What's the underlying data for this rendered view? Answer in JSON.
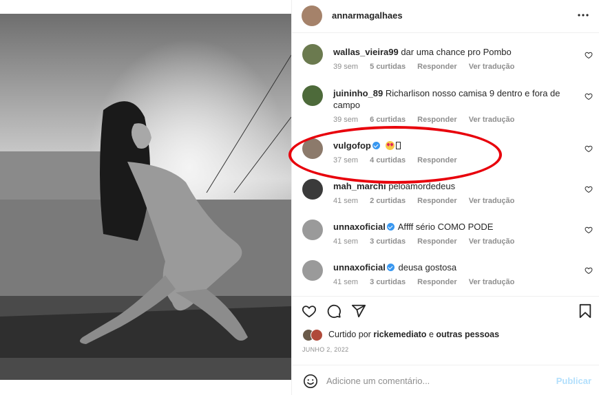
{
  "post": {
    "author": "annarmagalhaes",
    "photo_description": "black and white photo"
  },
  "comments": [
    {
      "user": "wallas_vieira99",
      "text": "dar uma chance pro Pombo",
      "age": "39 sem",
      "likes": "5 curtidas",
      "reply": "Responder",
      "translate": "Ver tradução",
      "verified": false
    },
    {
      "user": "juininho_89",
      "text": "Richarlison nosso camisa 9 dentro e fora de campo",
      "age": "39 sem",
      "likes": "6 curtidas",
      "reply": "Responder",
      "translate": "Ver tradução",
      "verified": false
    },
    {
      "user": "vulgofop",
      "text": "",
      "age": "37 sem",
      "likes": "4 curtidas",
      "reply": "Responder",
      "translate": "",
      "verified": true,
      "highlighted": true
    },
    {
      "user": "mah_marchi",
      "text": "peloamordedeus",
      "age": "41 sem",
      "likes": "2 curtidas",
      "reply": "Responder",
      "translate": "Ver tradução",
      "verified": false
    },
    {
      "user": "unnaxoficial",
      "text": "Affff sério COMO PODE",
      "age": "41 sem",
      "likes": "3 curtidas",
      "reply": "Responder",
      "translate": "Ver tradução",
      "verified": true
    },
    {
      "user": "unnaxoficial",
      "text": "deusa gostosa",
      "age": "41 sem",
      "likes": "3 curtidas",
      "reply": "Responder",
      "translate": "Ver tradução",
      "verified": true
    }
  ],
  "liked_by": {
    "prefix": "Curtido por",
    "user": "rickemediato",
    "connector": "e",
    "others": "outras pessoas"
  },
  "date": "JUNHO 2, 2022",
  "add_comment": {
    "placeholder": "Adicione um comentário...",
    "publish_label": "Publicar"
  },
  "colors": {
    "highlight_ring": "#e8000b",
    "verified_badge": "#3897f0",
    "publish_disabled": "#b2dffc",
    "meta_text": "#8e8e8e"
  },
  "icons": [
    "more-options-icon",
    "heart-icon",
    "comment-icon",
    "share-icon",
    "bookmark-icon",
    "emoji-icon",
    "verified-badge-icon"
  ]
}
